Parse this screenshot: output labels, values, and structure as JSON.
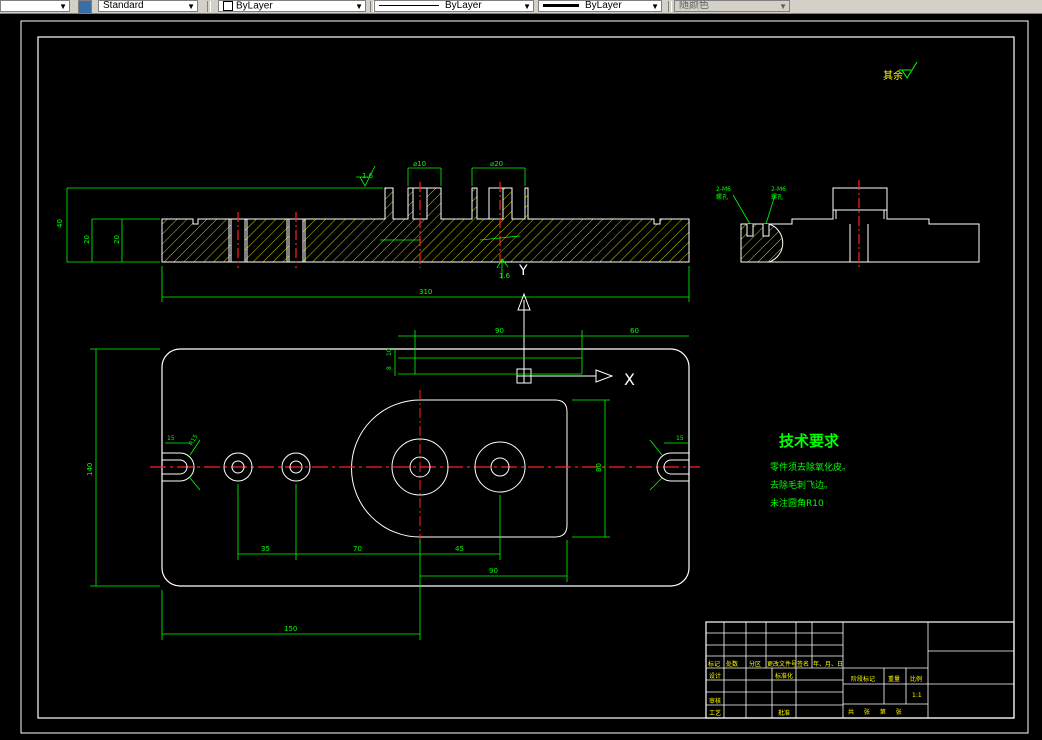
{
  "toolbar": {
    "text_style": "Standard",
    "layer": "ByLayer",
    "linetype": "ByLayer",
    "lineweight": "ByLayer",
    "plot_style": "随颜色"
  },
  "drawing": {
    "roughness_note": "其余",
    "dims_front": {
      "c10": "⌀10",
      "c20": "⌀20",
      "r16": "1.6",
      "h40": "40",
      "h20a": "20",
      "h20b": "20",
      "len310": "310",
      "r16b": "1.6"
    },
    "dims_top": {
      "d90": "90",
      "d60": "60",
      "d10": "10",
      "d8": "8",
      "w140": "140",
      "d35": "35",
      "d70": "70",
      "d45": "45",
      "d90b": "90",
      "d150": "150",
      "d80": "80",
      "r15": "R15",
      "s15a": "15",
      "s15b": "15"
    },
    "axis_x": "X",
    "axis_y": "Y",
    "side_labels": {
      "l1": "2-M6",
      "l2": "2-M6",
      "l3": "螺孔",
      "l4": "螺孔"
    },
    "tech_title": "技术要求",
    "tech_lines": [
      "零件须去除氧化皮。",
      "去除毛刺飞边。",
      "未注圆角R10"
    ]
  },
  "title_block": {
    "row_headers": [
      "标记",
      "处数",
      "分区",
      "更改文件号",
      "签名",
      "年、月、日"
    ],
    "design": "设计",
    "standardize": "标准化",
    "review": "审核",
    "process": "工艺",
    "approve": "批准",
    "stage": "阶段标记",
    "weight": "重量",
    "scale": "比例",
    "scale_value": "1:1",
    "sheet_info": "共 张 第 张"
  }
}
